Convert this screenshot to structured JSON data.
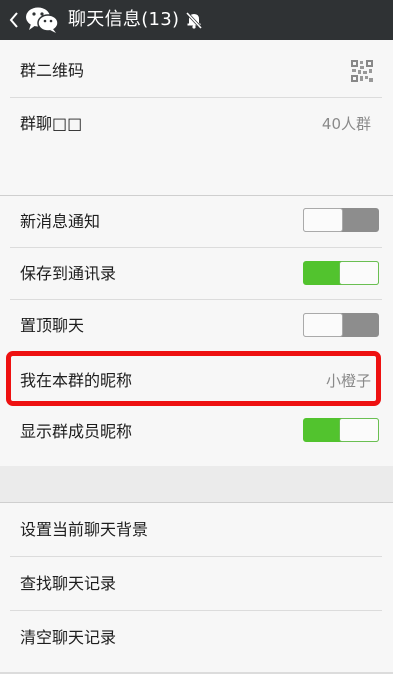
{
  "header": {
    "title": "聊天信息(13)",
    "icons": [
      "back-chevron-icon",
      "wechat-logo-icon",
      "mute-bell-icon"
    ]
  },
  "group_info": {
    "qr_code": {
      "label": "群二维码",
      "icon": "qr-code-icon"
    },
    "group_chat": {
      "label": "群聊□□",
      "value": "40人群"
    }
  },
  "settings": {
    "new_message_notify": {
      "label": "新消息通知",
      "enabled": false
    },
    "save_to_contacts": {
      "label": "保存到通讯录",
      "enabled": true
    },
    "pin_chat": {
      "label": "置顶聊天",
      "enabled": false
    },
    "my_nickname": {
      "label": "我在本群的昵称",
      "value": "小橙子",
      "highlighted": true
    },
    "show_member_nicknames": {
      "label": "显示群成员昵称",
      "enabled": true
    }
  },
  "actions": {
    "set_background": "设置当前聊天背景",
    "find_history": "查找聊天记录",
    "clear_history": "清空聊天记录"
  },
  "colors": {
    "header_bg": "#2f3234",
    "toggle_on": "#52c32e",
    "toggle_off": "#8d8d8d",
    "highlight_border": "#ee1111"
  }
}
